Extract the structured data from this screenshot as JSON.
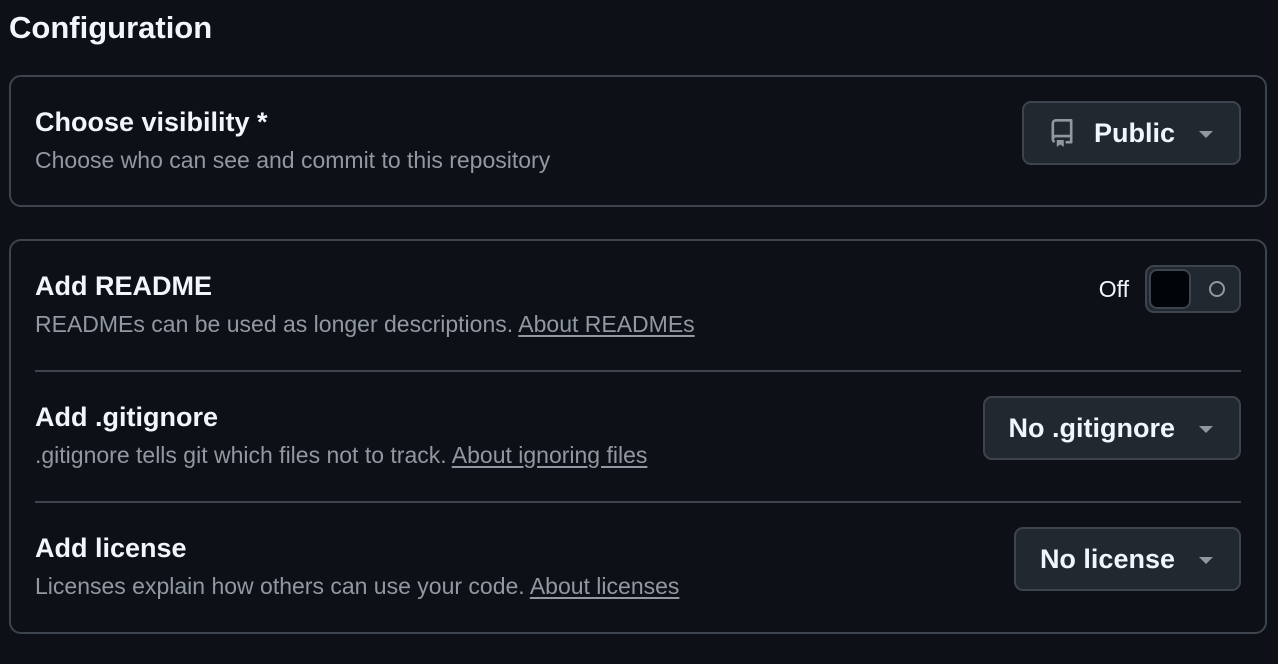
{
  "page_title": "Configuration",
  "visibility": {
    "title": "Choose visibility *",
    "description": "Choose who can see and commit to this repository",
    "select_value": "Public",
    "icon": "repo-icon"
  },
  "readme": {
    "title": "Add README",
    "description": "READMEs can be used as longer descriptions.",
    "link": "About READMEs",
    "toggle_label": "Off",
    "toggle_state": false
  },
  "gitignore": {
    "title": "Add .gitignore",
    "description": ".gitignore tells git which files not to track.",
    "link": "About ignoring files",
    "select_value": "No .gitignore"
  },
  "license": {
    "title": "Add license",
    "description": "Licenses explain how others can use your code.",
    "link": "About licenses",
    "select_value": "No license"
  },
  "colors": {
    "background": "#0d1117",
    "border": "#3d444d",
    "button_bg": "#212830",
    "text_primary": "#f0f6fc",
    "text_muted": "#9198a1"
  }
}
